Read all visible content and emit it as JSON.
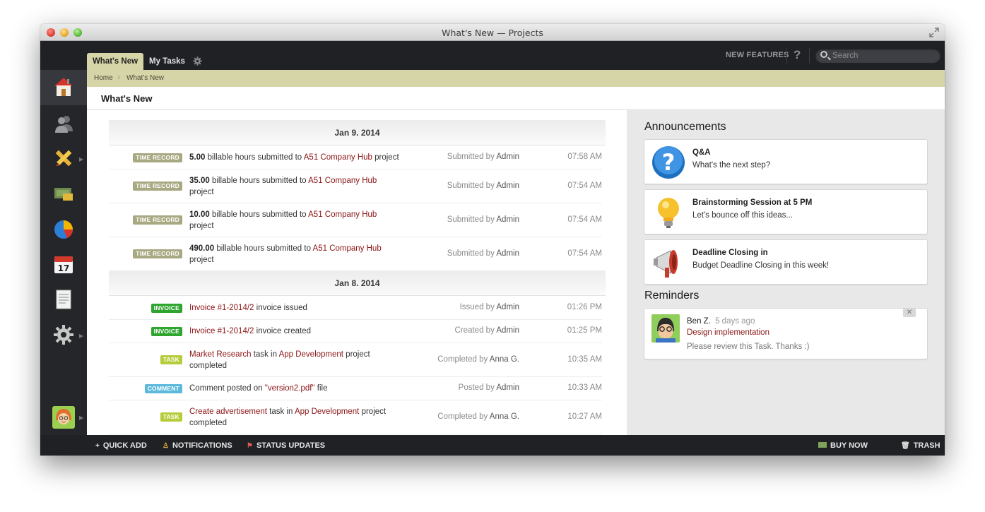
{
  "window": {
    "title": "What's New — Projects"
  },
  "topbar": {
    "tabs": [
      {
        "label": "What's New"
      },
      {
        "label": "My Tasks"
      }
    ],
    "new_features": "NEW FEATURES",
    "help": "?",
    "search_placeholder": "Search"
  },
  "sidebar": {
    "items": [
      {
        "icon": "home-icon"
      },
      {
        "icon": "people-icon"
      },
      {
        "icon": "pencil-ruler-icon"
      },
      {
        "icon": "money-icon"
      },
      {
        "icon": "pie-chart-icon"
      },
      {
        "icon": "calendar-icon",
        "day": "17"
      },
      {
        "icon": "document-icon"
      },
      {
        "icon": "gear-icon"
      }
    ]
  },
  "breadcrumb": [
    "Home",
    "What's New"
  ],
  "page_title": "What's New",
  "feed": {
    "days": [
      {
        "date": "Jan 9. 2014",
        "rows": [
          {
            "badge": "TIME RECORD",
            "amount": "5.00",
            "mid": " billable hours submitted to ",
            "link": "A51 Company Hub",
            "after": " project",
            "action": "Submitted",
            "by": "by",
            "who": "Admin",
            "time": "07:58 AM"
          },
          {
            "badge": "TIME RECORD",
            "amount": "35.00",
            "mid": " billable hours submitted to ",
            "link": "A51 Company Hub",
            "after": " project",
            "action": "Submitted",
            "by": "by",
            "who": "Admin",
            "time": "07:54 AM"
          },
          {
            "badge": "TIME RECORD",
            "amount": "10.00",
            "mid": " billable hours submitted to ",
            "link": "A51 Company Hub",
            "after": " project",
            "action": "Submitted",
            "by": "by",
            "who": "Admin",
            "time": "07:54 AM"
          },
          {
            "badge": "TIME RECORD",
            "amount": "490.00",
            "mid": " billable hours submitted to ",
            "link": "A51 Company Hub",
            "after": " project",
            "action": "Submitted",
            "by": "by",
            "who": "Admin",
            "time": "07:54 AM"
          }
        ]
      },
      {
        "date": "Jan 8. 2014",
        "rows": [
          {
            "badge": "INVOICE",
            "link": "Invoice #1-2014/2",
            "after": " invoice issued",
            "action": "Issued",
            "by": "by",
            "who": "Admin",
            "time": "01:26 PM"
          },
          {
            "badge": "INVOICE",
            "link": "Invoice #1-2014/2",
            "after": " invoice created",
            "action": "Created",
            "by": "by",
            "who": "Admin",
            "time": "01:25 PM"
          },
          {
            "badge": "TASK",
            "link": "Market Research",
            "mid": " task in ",
            "link2": "App Development",
            "after": " project completed",
            "action": "Completed",
            "by": "by",
            "who": "Anna G.",
            "time": "10:35 AM"
          },
          {
            "badge": "COMMENT",
            "pre": "Comment posted on ",
            "link": "\"version2.pdf\"",
            "after": " file",
            "action": "Posted",
            "by": "by",
            "who": "Admin",
            "time": "10:33 AM"
          },
          {
            "badge": "TASK",
            "link": "Create advertisement",
            "mid": " task in ",
            "link2": "App Development",
            "after": " project completed",
            "action": "Completed",
            "by": "by",
            "who": "Anna G.",
            "time": "10:27 AM"
          }
        ]
      }
    ]
  },
  "announcements": {
    "title": "Announcements",
    "items": [
      {
        "icon": "question-icon",
        "title": "Q&A",
        "text": "What's the next step?"
      },
      {
        "icon": "lightbulb-icon",
        "title": "Brainstorming Session at 5 PM",
        "text": "Let's bounce off this ideas..."
      },
      {
        "icon": "megaphone-icon",
        "title": "Deadline Closing in",
        "text": "Budget Deadline Closing in this week!"
      }
    ]
  },
  "reminders": {
    "title": "Reminders",
    "items": [
      {
        "name": "Ben Z.",
        "ago": "5 days ago",
        "link": "Design implementation",
        "text": "Please review this Task. Thanks :)",
        "close": "✕"
      }
    ]
  },
  "bottombar": {
    "quick_add": "QUICK ADD",
    "notifications": "NOTIFICATIONS",
    "status_updates": "STATUS UPDATES",
    "buy_now": "BUY NOW",
    "trash": "TRASH"
  },
  "colors": {
    "accent_tab": "#d6d5a8",
    "link": "#8b1414",
    "dark_bar": "#1f2125",
    "invoice": "#2fa52f",
    "task": "#b7cc3a",
    "comment": "#5db9db",
    "time_record": "#a8a882"
  }
}
